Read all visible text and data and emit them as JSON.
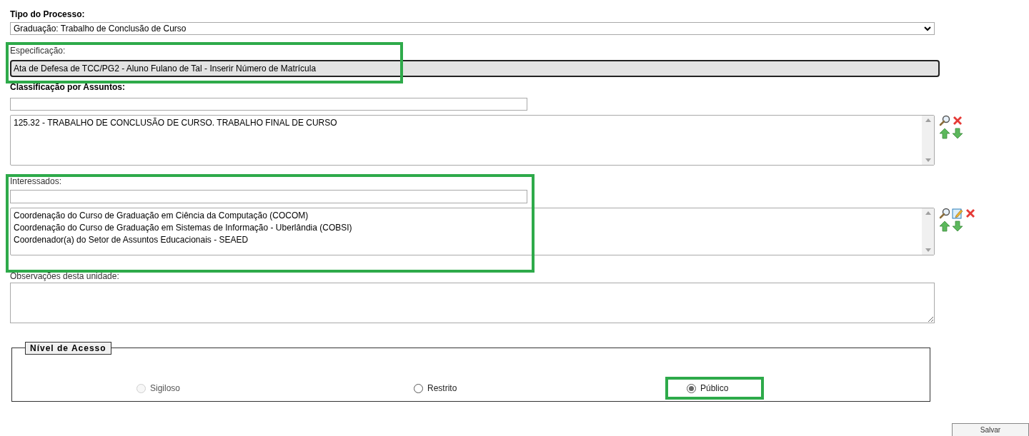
{
  "tipo_processo": {
    "label": "Tipo do Processo:",
    "value": "Graduação: Trabalho de Conclusão de Curso"
  },
  "especificacao": {
    "label": "Especificação:",
    "value": "Ata de Defesa de TCC/PG2 - Aluno Fulano de Tal - Inserir Número de Matrícula",
    "highlighted": true
  },
  "classificacao": {
    "label": "Classificação por Assuntos:",
    "items": [
      "125.32 - TRABALHO DE CONCLUSÃO DE CURSO. TRABALHO FINAL DE CURSO"
    ]
  },
  "interessados": {
    "label": "Interessados:",
    "highlighted": true,
    "items": [
      "Coordenação do Curso de Graduação em Ciência da Computação (COCOM)",
      "Coordenação do Curso de Graduação em Sistemas de Informação - Uberlândia (COBSI)",
      "Coordenador(a) do Setor de Assuntos Educacionais - SEAED"
    ]
  },
  "observacoes": {
    "label": "Observações desta unidade:"
  },
  "nivel_acesso": {
    "legend": "Nível de Acesso",
    "options": [
      {
        "label": "Sigiloso",
        "selected": false,
        "disabled": true,
        "highlighted": false
      },
      {
        "label": "Restrito",
        "selected": false,
        "disabled": false,
        "highlighted": false
      },
      {
        "label": "Público",
        "selected": true,
        "disabled": false,
        "highlighted": true
      }
    ]
  },
  "buttons": [
    "Salvar"
  ]
}
